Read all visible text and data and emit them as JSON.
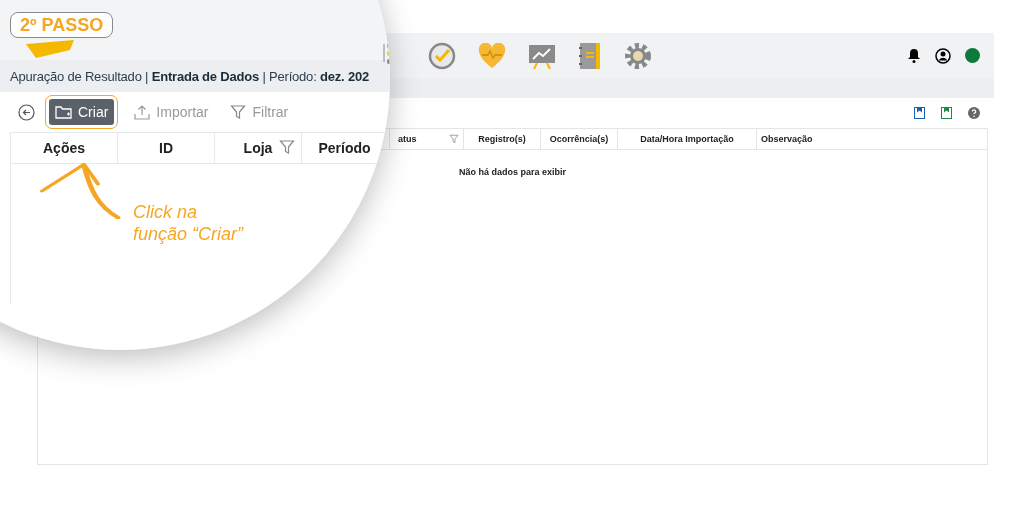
{
  "step_badge": "2º PASSO",
  "breadcrumb": "Apuração de Resultado | **Entrada de Dados** | Período: **dez. 202**",
  "toolbar": [
    {
      "kind": "create",
      "label": "Criar",
      "highlighted": true
    },
    {
      "kind": "import",
      "label": "Importar",
      "highlighted": false
    },
    {
      "kind": "filter",
      "label": "Filtrar",
      "highlighted": false
    }
  ],
  "zoomed_columns": [
    {
      "label": "Ações",
      "filter": false
    },
    {
      "label": "ID",
      "filter": false
    },
    {
      "label": "Loja",
      "filter": true
    },
    {
      "label": "Período",
      "filter": false
    }
  ],
  "table": {
    "columns": [
      {
        "label": "atus",
        "filter": true
      },
      {
        "label": "Registro(s)",
        "filter": false
      },
      {
        "label": "Ocorrência(s)",
        "filter": false
      },
      {
        "label": "Data/Hora Importação",
        "filter": false
      },
      {
        "label": "Observação",
        "filter": false
      }
    ],
    "empty_message": "Não há dados para exibir"
  },
  "callout": [
    "Click na",
    "função “Criar”"
  ]
}
